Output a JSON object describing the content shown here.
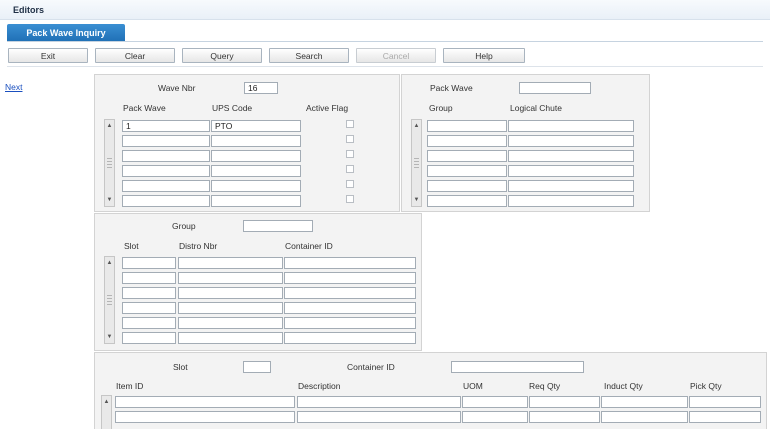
{
  "app": {
    "title": "Editors"
  },
  "tab": {
    "label": "Pack Wave Inquiry"
  },
  "toolbar": {
    "exit": "Exit",
    "clear": "Clear",
    "query": "Query",
    "search": "Search",
    "cancel": "Cancel",
    "help": "Help"
  },
  "nav": {
    "next": "Next"
  },
  "wave_panel": {
    "wave_nbr_label": "Wave Nbr",
    "wave_nbr_value": "16",
    "columns": {
      "pack_wave": "Pack Wave",
      "ups_code": "UPS Code",
      "active_flag": "Active Flag"
    },
    "rows": [
      {
        "pack_wave": "1",
        "ups_code": "PTO"
      },
      {
        "pack_wave": "",
        "ups_code": ""
      },
      {
        "pack_wave": "",
        "ups_code": ""
      },
      {
        "pack_wave": "",
        "ups_code": ""
      },
      {
        "pack_wave": "",
        "ups_code": ""
      },
      {
        "pack_wave": "",
        "ups_code": ""
      }
    ]
  },
  "chute_panel": {
    "pack_wave_label": "Pack Wave",
    "pack_wave_value": "",
    "columns": {
      "group": "Group",
      "logical_chute": "Logical Chute"
    }
  },
  "slot_panel": {
    "group_label": "Group",
    "group_value": "",
    "columns": {
      "slot": "Slot",
      "distro_nbr": "Distro Nbr",
      "container_id": "Container ID"
    }
  },
  "item_panel": {
    "slot_label": "Slot",
    "slot_value": "",
    "container_id_label": "Container ID",
    "container_id_value": "",
    "columns": {
      "item_id": "Item ID",
      "description": "Description",
      "uom": "UOM",
      "req_qty": "Req Qty",
      "induct_qty": "Induct Qty",
      "pick_qty": "Pick Qty"
    }
  }
}
